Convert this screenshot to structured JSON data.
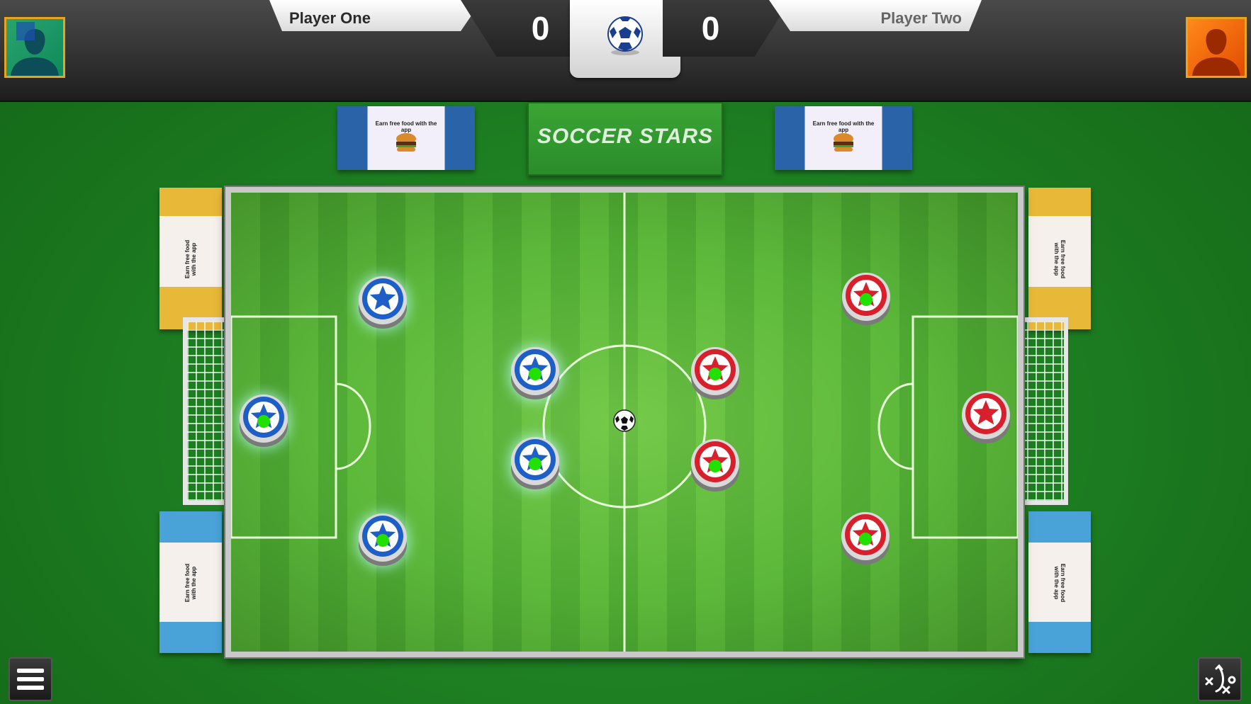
{
  "scoreboard": {
    "player_one": {
      "name": "Player One",
      "score": "0"
    },
    "player_two": {
      "name": "Player Two",
      "score": "0"
    }
  },
  "banners": {
    "logo": "SOCCER STARS",
    "ad_caption": "Earn free food with the app"
  },
  "colors": {
    "team_one": "#1d5fc6",
    "team_two": "#d8202c",
    "center_marker": "#22e000",
    "pitch": "#5cb83a",
    "frame": "#e8a420"
  },
  "icons": {
    "center_badge": "soccer-ball-icon",
    "menu": "hamburger-menu-icon",
    "tactics": "tactics-play-icon"
  }
}
